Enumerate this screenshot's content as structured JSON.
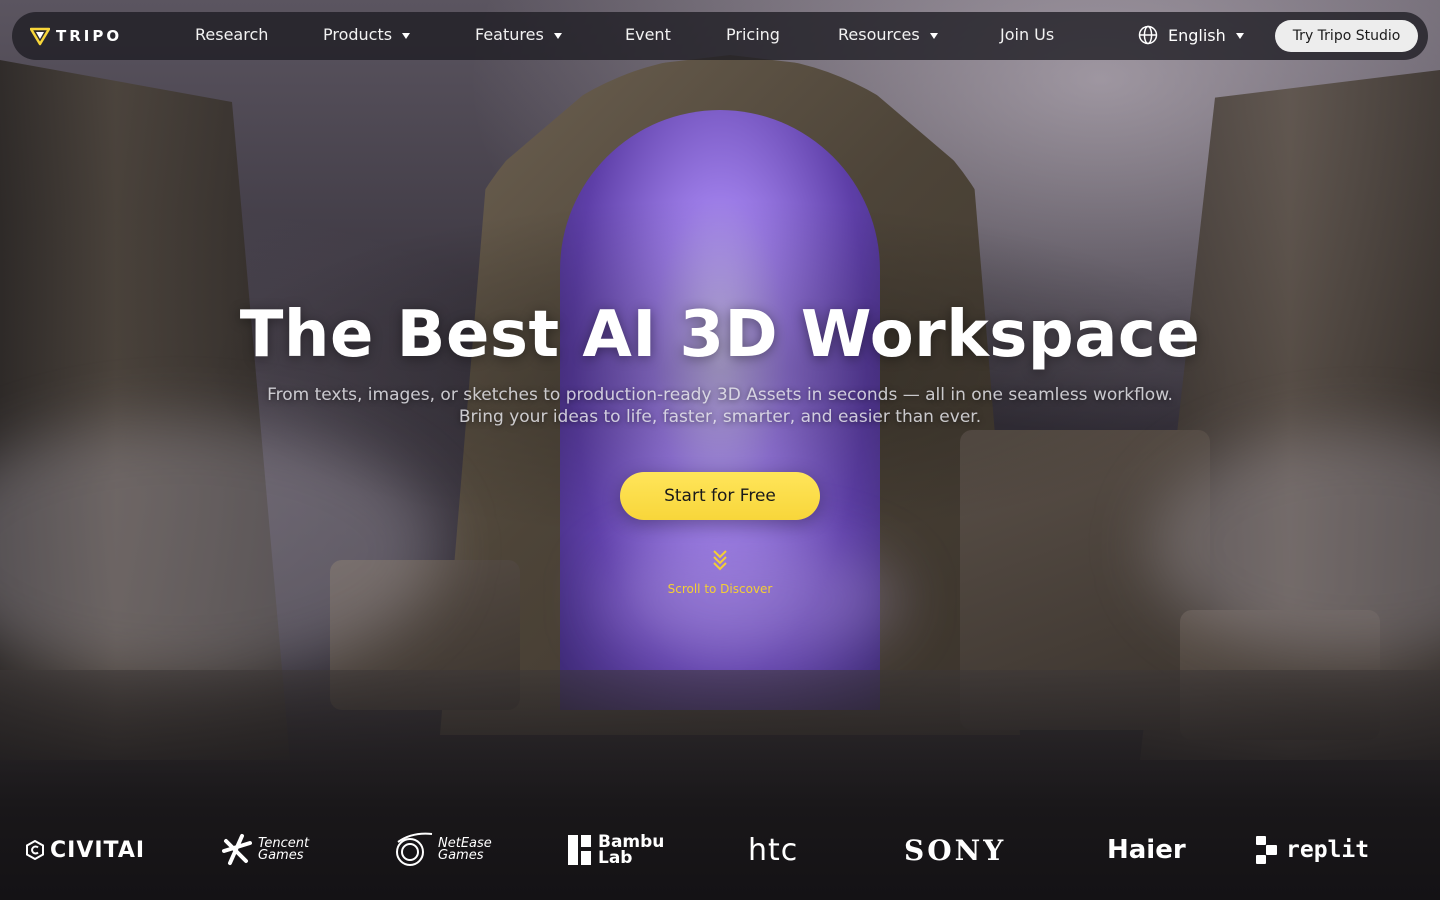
{
  "nav": {
    "logo_text": "TRIPO",
    "items": [
      {
        "label": "Research",
        "dropdown": false
      },
      {
        "label": "Products",
        "dropdown": true
      },
      {
        "label": "Features",
        "dropdown": true
      },
      {
        "label": "Event",
        "dropdown": false
      },
      {
        "label": "Pricing",
        "dropdown": false
      },
      {
        "label": "Resources",
        "dropdown": true
      },
      {
        "label": "Join Us",
        "dropdown": false
      }
    ],
    "language": "English",
    "studio_button": "Try Tripo Studio"
  },
  "hero": {
    "title": "The Best AI 3D Workspace",
    "subtitle_line1": "From texts, images, or sketches to production-ready 3D Assets in seconds — all in one seamless workflow.",
    "subtitle_line2": "Bring your ideas to life, faster, smarter, and easier than ever.",
    "cta": "Start for Free",
    "scroll_hint": "Scroll to Discover"
  },
  "brands": {
    "civitai": "CIVITAI",
    "tencent_1": "Tencent",
    "tencent_2": "Games",
    "netease_1": "NetEase",
    "netease_2": "Games",
    "bambu_1": "Bambu",
    "bambu_2": "Lab",
    "htc": "htc",
    "sony": "SONY",
    "haier": "Haier",
    "replit": "replit"
  },
  "colors": {
    "accent": "#f8d63a",
    "nav_bg": "#1e1c22",
    "studio_button_bg": "#ededed"
  }
}
